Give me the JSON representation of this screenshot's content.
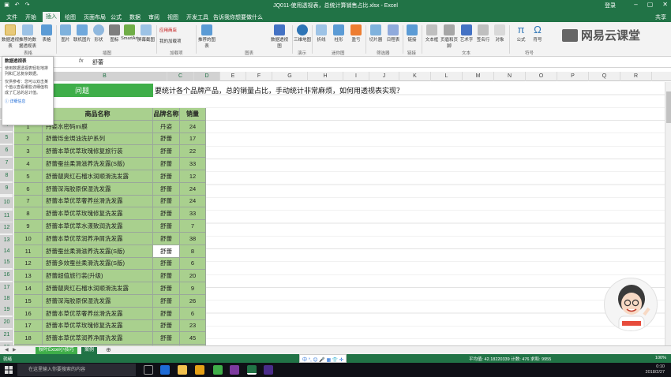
{
  "window": {
    "title": "JQ011-使用透视表，总统计算销售占比.xlsx - Excel",
    "login": "登录",
    "share": "共享"
  },
  "tabs": [
    "文件",
    "开始",
    "插入",
    "绘图",
    "页面布局",
    "公式",
    "数据",
    "审阅",
    "视图",
    "开发工具",
    "告诉我你想要做什么"
  ],
  "ribbon": {
    "buttons": [
      "数据透视表",
      "推荐的数据透视表",
      "表格",
      "图片",
      "联机图片",
      "形状",
      "图标",
      "SmartArt",
      "屏幕截图",
      "应用商店",
      "我的加载项",
      "推荐的图表",
      "数据透视图",
      "三维地图",
      "折线",
      "柱形",
      "盈亏",
      "切片器",
      "日程表",
      "链接",
      "文本框",
      "页眉和页脚",
      "艺术字",
      "签名行",
      "对象",
      "公式",
      "符号"
    ],
    "groups": [
      "表格",
      "插图",
      "加载项",
      "图表",
      "演示",
      "迷你图",
      "筛选器",
      "链接",
      "文本",
      "符号"
    ],
    "brand": "网易云课堂"
  },
  "tooltip": {
    "title": "数据透视表",
    "body": "使用数据透视表轻松地排列和汇总复杂数据。",
    "extra": "仅供参考：您可以双击某个值以查看哪些详细值构成了汇总的总计值。",
    "more": "详细信息"
  },
  "formula_bar": {
    "fx": "fx",
    "value": "舒蕾"
  },
  "columns": [
    "A",
    "B",
    "C",
    "D",
    "E",
    "F",
    "G",
    "H",
    "I",
    "J",
    "K",
    "L",
    "M",
    "N",
    "O",
    "P",
    "Q",
    "R"
  ],
  "row_numbers": [
    "1",
    "2",
    "3",
    "4",
    "5",
    "6",
    "7",
    "8",
    "9",
    "10",
    "11",
    "12",
    "13",
    "14",
    "15",
    "16",
    "17",
    "18",
    "19",
    "20",
    "21",
    "22",
    "23"
  ],
  "question": {
    "label": "问题",
    "text": "要统计各个品牌产品，总的销量占比，手动统计非常麻烦，如何用透视表实现？"
  },
  "table_headers": [
    "商品名称",
    "品牌名称",
    "销量"
  ],
  "table_rows": [
    {
      "no": "1",
      "name": "丹姿水密码mi膜",
      "brand": "丹姿",
      "qty": "24"
    },
    {
      "no": "2",
      "name": "舒蕾烁金焗油洗护系列",
      "brand": "舒蕾",
      "qty": "17"
    },
    {
      "no": "3",
      "name": "舒蕾本草优萃玫瑰修复旅行装",
      "brand": "舒蕾",
      "qty": "22"
    },
    {
      "no": "4",
      "name": "舒蕾蚕丝柔滑滋养洗发露(S版)",
      "brand": "舒蕾",
      "qty": "33"
    },
    {
      "no": "5",
      "name": "舒蕾靓爽红石榴水润顺滑洗发露",
      "brand": "舒蕾",
      "qty": "12"
    },
    {
      "no": "6",
      "name": "舒蕾深海胶原保湿洗发露",
      "brand": "舒蕾",
      "qty": "24"
    },
    {
      "no": "7",
      "name": "舒蕾本草优萃奢养丝滑洗发露",
      "brand": "舒蕾",
      "qty": "24"
    },
    {
      "no": "8",
      "name": "舒蕾本草优萃玫瑰修复洗发露",
      "brand": "舒蕾",
      "qty": "33"
    },
    {
      "no": "9",
      "name": "舒蕾本草优萃水漾致润洗发露",
      "brand": "舒蕾",
      "qty": "7"
    },
    {
      "no": "10",
      "name": "舒蕾本草优萃润养净屑洗发露",
      "brand": "舒蕾",
      "qty": "38"
    },
    {
      "no": "11",
      "name": "舒蕾蚕丝柔滑滋养洗发露(S版)",
      "brand": "舒蕾",
      "qty": "8"
    },
    {
      "no": "12",
      "name": "舒蕾多效蚕丝柔滑洗发露(S版)",
      "brand": "舒蕾",
      "qty": "6"
    },
    {
      "no": "13",
      "name": "舒蕾超值旅行装(升级)",
      "brand": "舒蕾",
      "qty": "20"
    },
    {
      "no": "14",
      "name": "舒蕾靓爽红石榴水润顺滑洗发露",
      "brand": "舒蕾",
      "qty": "9"
    },
    {
      "no": "15",
      "name": "舒蕾深海胶原保湿洗发露",
      "brand": "舒蕾",
      "qty": "26"
    },
    {
      "no": "16",
      "name": "舒蕾本草优萃奢养丝滑洗发露",
      "brand": "舒蕾",
      "qty": "6"
    },
    {
      "no": "17",
      "name": "舒蕾本草优萃玫瑰修复洗发露",
      "brand": "舒蕾",
      "qty": "23"
    },
    {
      "no": "18",
      "name": "舒蕾本草优萃润养净屑洗发露",
      "brand": "舒蕾",
      "qty": "45"
    },
    {
      "no": "19",
      "name": "舒蕾本草优萃奢养丝滑洗发露",
      "brand": "舒蕾",
      "qty": "38"
    }
  ],
  "sheets": [
    "秋叶Excel小技巧",
    "案例"
  ],
  "status": {
    "left": "就绪",
    "stats": "平均值: 42.18220339   计数: 476   求和: 9955",
    "zoom": "100%"
  },
  "ime": "中 °, 😊 🎤 ▦ 👕 ✣",
  "taskbar": {
    "search_placeholder": "在这里输入你要搜索的内容",
    "time": "0:10",
    "date": "2018/2/27"
  },
  "colors": {
    "excel_green": "#217346",
    "question_green": "#3fae49",
    "table_green": "#a9d08e"
  }
}
